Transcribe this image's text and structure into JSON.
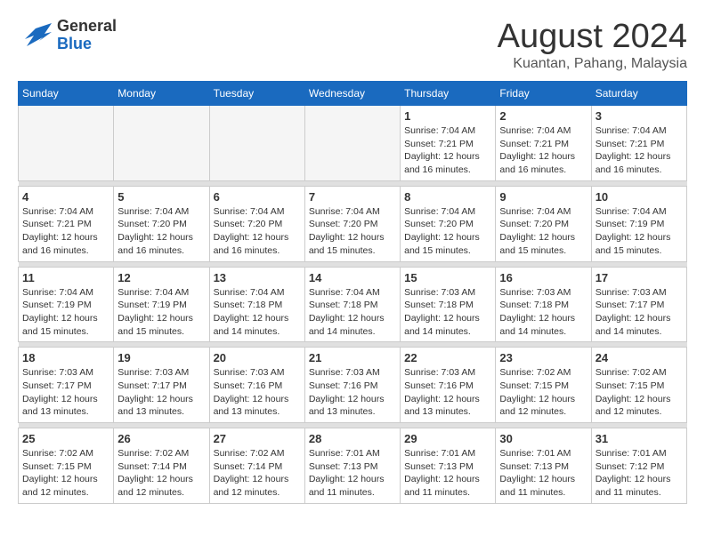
{
  "header": {
    "logo_general": "General",
    "logo_blue": "Blue",
    "title": "August 2024",
    "subtitle": "Kuantan, Pahang, Malaysia"
  },
  "weekdays": [
    "Sunday",
    "Monday",
    "Tuesday",
    "Wednesday",
    "Thursday",
    "Friday",
    "Saturday"
  ],
  "weeks": [
    [
      {
        "day": "",
        "sunrise": "",
        "sunset": "",
        "daylight": ""
      },
      {
        "day": "",
        "sunrise": "",
        "sunset": "",
        "daylight": ""
      },
      {
        "day": "",
        "sunrise": "",
        "sunset": "",
        "daylight": ""
      },
      {
        "day": "",
        "sunrise": "",
        "sunset": "",
        "daylight": ""
      },
      {
        "day": "1",
        "sunrise": "Sunrise: 7:04 AM",
        "sunset": "Sunset: 7:21 PM",
        "daylight": "Daylight: 12 hours and 16 minutes."
      },
      {
        "day": "2",
        "sunrise": "Sunrise: 7:04 AM",
        "sunset": "Sunset: 7:21 PM",
        "daylight": "Daylight: 12 hours and 16 minutes."
      },
      {
        "day": "3",
        "sunrise": "Sunrise: 7:04 AM",
        "sunset": "Sunset: 7:21 PM",
        "daylight": "Daylight: 12 hours and 16 minutes."
      }
    ],
    [
      {
        "day": "4",
        "sunrise": "Sunrise: 7:04 AM",
        "sunset": "Sunset: 7:21 PM",
        "daylight": "Daylight: 12 hours and 16 minutes."
      },
      {
        "day": "5",
        "sunrise": "Sunrise: 7:04 AM",
        "sunset": "Sunset: 7:20 PM",
        "daylight": "Daylight: 12 hours and 16 minutes."
      },
      {
        "day": "6",
        "sunrise": "Sunrise: 7:04 AM",
        "sunset": "Sunset: 7:20 PM",
        "daylight": "Daylight: 12 hours and 16 minutes."
      },
      {
        "day": "7",
        "sunrise": "Sunrise: 7:04 AM",
        "sunset": "Sunset: 7:20 PM",
        "daylight": "Daylight: 12 hours and 15 minutes."
      },
      {
        "day": "8",
        "sunrise": "Sunrise: 7:04 AM",
        "sunset": "Sunset: 7:20 PM",
        "daylight": "Daylight: 12 hours and 15 minutes."
      },
      {
        "day": "9",
        "sunrise": "Sunrise: 7:04 AM",
        "sunset": "Sunset: 7:20 PM",
        "daylight": "Daylight: 12 hours and 15 minutes."
      },
      {
        "day": "10",
        "sunrise": "Sunrise: 7:04 AM",
        "sunset": "Sunset: 7:19 PM",
        "daylight": "Daylight: 12 hours and 15 minutes."
      }
    ],
    [
      {
        "day": "11",
        "sunrise": "Sunrise: 7:04 AM",
        "sunset": "Sunset: 7:19 PM",
        "daylight": "Daylight: 12 hours and 15 minutes."
      },
      {
        "day": "12",
        "sunrise": "Sunrise: 7:04 AM",
        "sunset": "Sunset: 7:19 PM",
        "daylight": "Daylight: 12 hours and 15 minutes."
      },
      {
        "day": "13",
        "sunrise": "Sunrise: 7:04 AM",
        "sunset": "Sunset: 7:18 PM",
        "daylight": "Daylight: 12 hours and 14 minutes."
      },
      {
        "day": "14",
        "sunrise": "Sunrise: 7:04 AM",
        "sunset": "Sunset: 7:18 PM",
        "daylight": "Daylight: 12 hours and 14 minutes."
      },
      {
        "day": "15",
        "sunrise": "Sunrise: 7:03 AM",
        "sunset": "Sunset: 7:18 PM",
        "daylight": "Daylight: 12 hours and 14 minutes."
      },
      {
        "day": "16",
        "sunrise": "Sunrise: 7:03 AM",
        "sunset": "Sunset: 7:18 PM",
        "daylight": "Daylight: 12 hours and 14 minutes."
      },
      {
        "day": "17",
        "sunrise": "Sunrise: 7:03 AM",
        "sunset": "Sunset: 7:17 PM",
        "daylight": "Daylight: 12 hours and 14 minutes."
      }
    ],
    [
      {
        "day": "18",
        "sunrise": "Sunrise: 7:03 AM",
        "sunset": "Sunset: 7:17 PM",
        "daylight": "Daylight: 12 hours and 13 minutes."
      },
      {
        "day": "19",
        "sunrise": "Sunrise: 7:03 AM",
        "sunset": "Sunset: 7:17 PM",
        "daylight": "Daylight: 12 hours and 13 minutes."
      },
      {
        "day": "20",
        "sunrise": "Sunrise: 7:03 AM",
        "sunset": "Sunset: 7:16 PM",
        "daylight": "Daylight: 12 hours and 13 minutes."
      },
      {
        "day": "21",
        "sunrise": "Sunrise: 7:03 AM",
        "sunset": "Sunset: 7:16 PM",
        "daylight": "Daylight: 12 hours and 13 minutes."
      },
      {
        "day": "22",
        "sunrise": "Sunrise: 7:03 AM",
        "sunset": "Sunset: 7:16 PM",
        "daylight": "Daylight: 12 hours and 13 minutes."
      },
      {
        "day": "23",
        "sunrise": "Sunrise: 7:02 AM",
        "sunset": "Sunset: 7:15 PM",
        "daylight": "Daylight: 12 hours and 12 minutes."
      },
      {
        "day": "24",
        "sunrise": "Sunrise: 7:02 AM",
        "sunset": "Sunset: 7:15 PM",
        "daylight": "Daylight: 12 hours and 12 minutes."
      }
    ],
    [
      {
        "day": "25",
        "sunrise": "Sunrise: 7:02 AM",
        "sunset": "Sunset: 7:15 PM",
        "daylight": "Daylight: 12 hours and 12 minutes."
      },
      {
        "day": "26",
        "sunrise": "Sunrise: 7:02 AM",
        "sunset": "Sunset: 7:14 PM",
        "daylight": "Daylight: 12 hours and 12 minutes."
      },
      {
        "day": "27",
        "sunrise": "Sunrise: 7:02 AM",
        "sunset": "Sunset: 7:14 PM",
        "daylight": "Daylight: 12 hours and 12 minutes."
      },
      {
        "day": "28",
        "sunrise": "Sunrise: 7:01 AM",
        "sunset": "Sunset: 7:13 PM",
        "daylight": "Daylight: 12 hours and 11 minutes."
      },
      {
        "day": "29",
        "sunrise": "Sunrise: 7:01 AM",
        "sunset": "Sunset: 7:13 PM",
        "daylight": "Daylight: 12 hours and 11 minutes."
      },
      {
        "day": "30",
        "sunrise": "Sunrise: 7:01 AM",
        "sunset": "Sunset: 7:13 PM",
        "daylight": "Daylight: 12 hours and 11 minutes."
      },
      {
        "day": "31",
        "sunrise": "Sunrise: 7:01 AM",
        "sunset": "Sunset: 7:12 PM",
        "daylight": "Daylight: 12 hours and 11 minutes."
      }
    ]
  ]
}
